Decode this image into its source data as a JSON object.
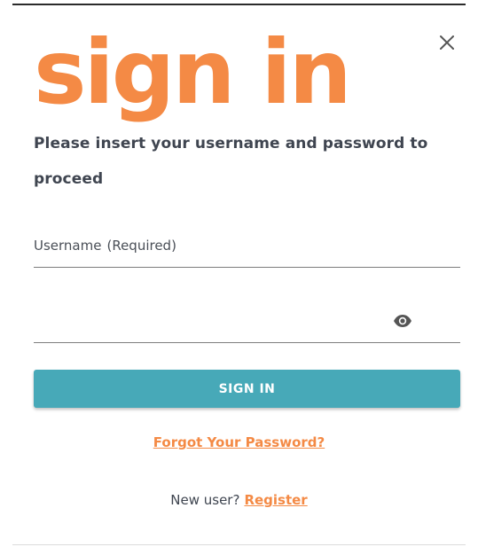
{
  "dialog": {
    "title": "sign in",
    "subtitle": "Please insert your username and password to proceed"
  },
  "username": {
    "label": "Username",
    "required": "(Required)",
    "value": ""
  },
  "password": {
    "value": ""
  },
  "actions": {
    "signin_label": "SIGN IN",
    "forgot_label": "Forgot Your Password?",
    "new_user_text": "New user?",
    "register_label": "Register"
  },
  "icons": {
    "close": "close-icon",
    "eye": "eye-icon"
  },
  "colors": {
    "accent": "#f48a45",
    "button": "#47a9b8"
  }
}
